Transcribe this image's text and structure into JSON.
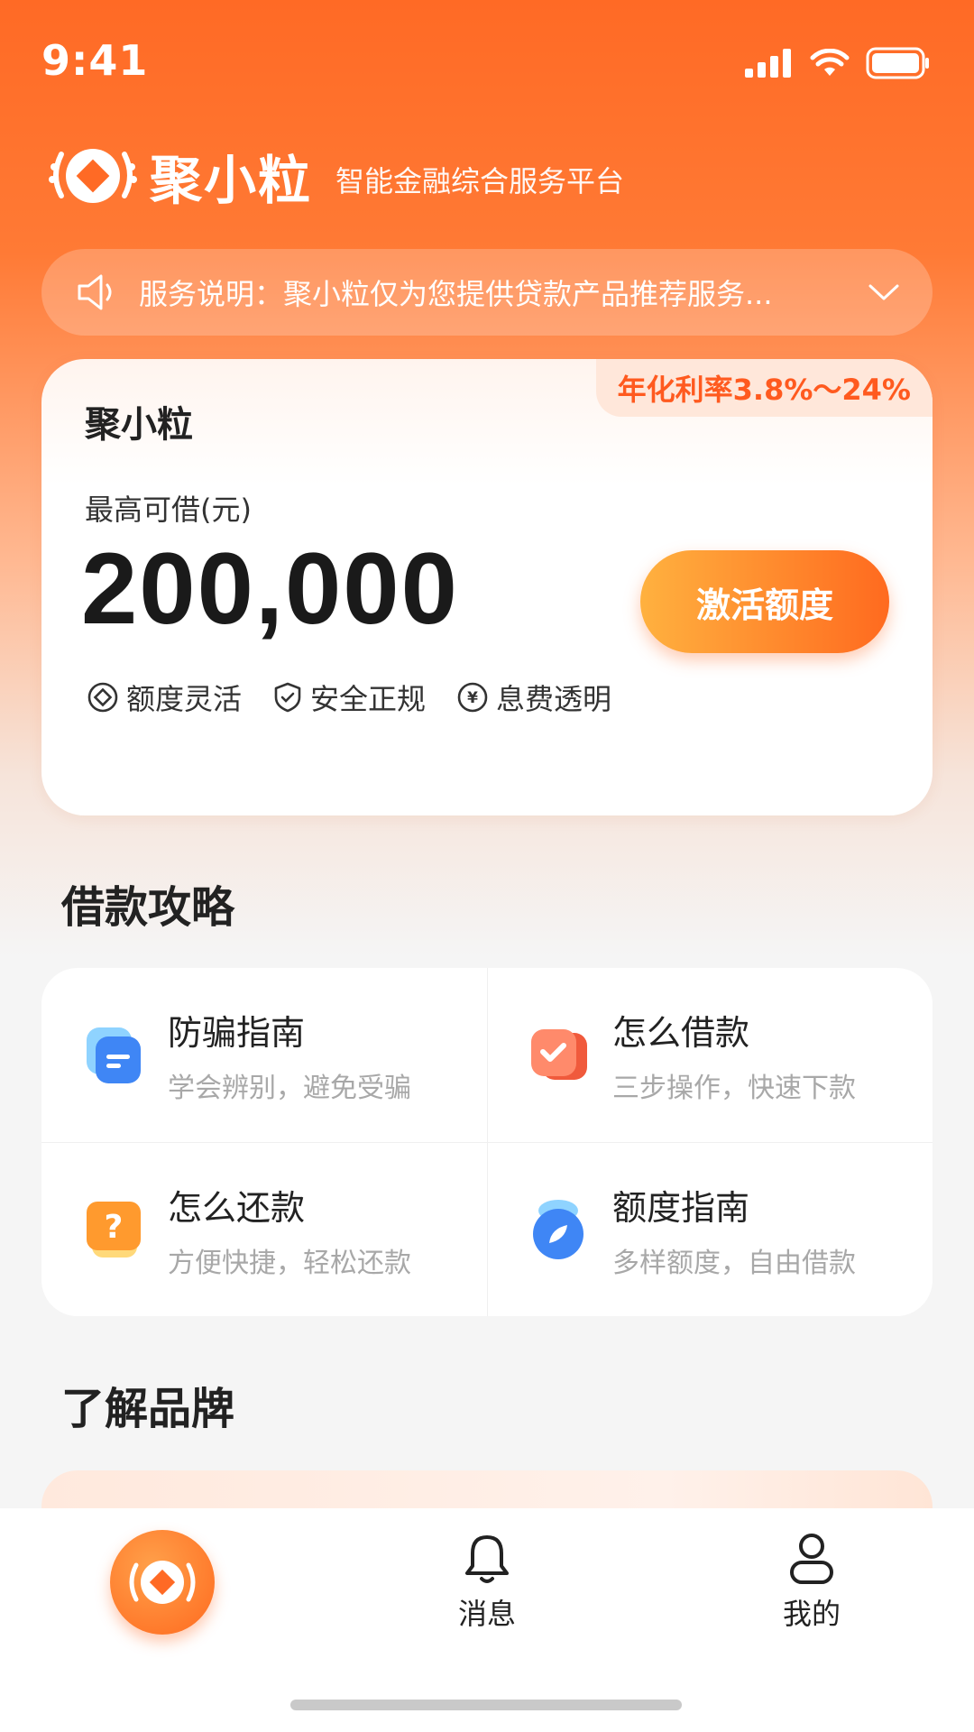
{
  "status_bar": {
    "time": "9:41"
  },
  "brand": {
    "name": "聚小粒",
    "slogan": "智能金融综合服务平台"
  },
  "notice": {
    "text": "服务说明：聚小粒仅为您提供贷款产品推荐服务..."
  },
  "loan_card": {
    "title": "聚小粒",
    "rate_tag": "年化利率3.8%～24%",
    "amount_label": "最高可借(元)",
    "amount": "200,000",
    "activate_button": "激活额度",
    "features": [
      {
        "label": "额度灵活",
        "icon": "diamond-circle-icon"
      },
      {
        "label": "安全正规",
        "icon": "shield-check-icon"
      },
      {
        "label": "息费透明",
        "icon": "yen-circle-icon"
      }
    ]
  },
  "guide_section": {
    "title": "借款攻略",
    "items": [
      {
        "title": "防骗指南",
        "subtitle": "学会辨别，避免受骗",
        "icon": "document-icon"
      },
      {
        "title": "怎么借款",
        "subtitle": "三步操作，快速下款",
        "icon": "checklist-icon"
      },
      {
        "title": "怎么还款",
        "subtitle": "方便快捷，轻松还款",
        "icon": "question-icon"
      },
      {
        "title": "额度指南",
        "subtitle": "多样额度，自由借款",
        "icon": "compass-icon"
      }
    ]
  },
  "brand_section": {
    "title": "了解品牌"
  },
  "tabbar": {
    "tabs": [
      {
        "label": "",
        "icon": "home-logo-icon"
      },
      {
        "label": "消息",
        "icon": "bell-icon"
      },
      {
        "label": "我的",
        "icon": "user-icon"
      }
    ]
  },
  "colors": {
    "primary": "#ff6a1f",
    "accent": "#ffb13f"
  }
}
